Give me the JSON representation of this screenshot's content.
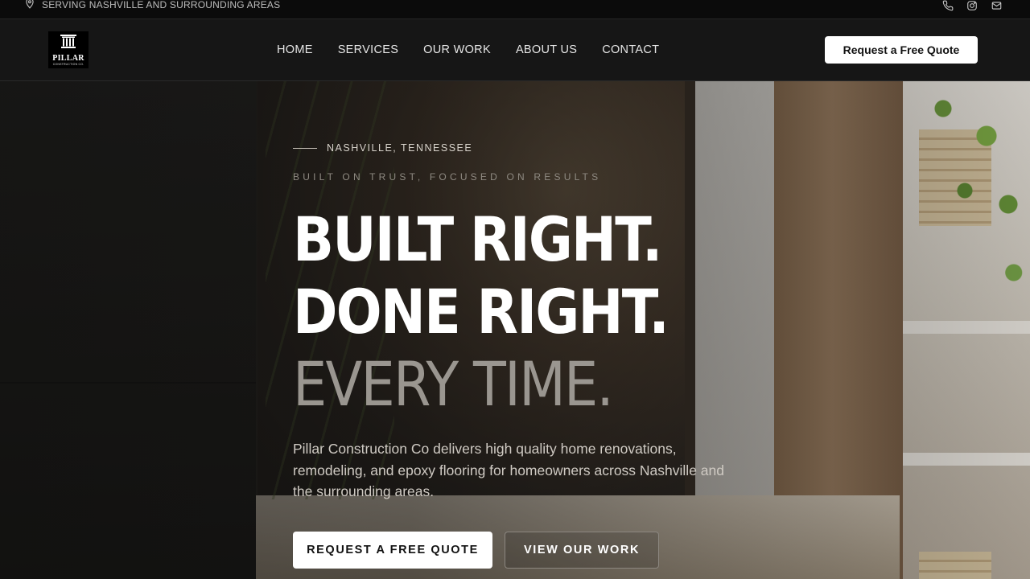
{
  "topbar": {
    "location_icon": "map-pin-icon",
    "location_text": "SERVING NASHVILLE AND SURROUNDING AREAS",
    "icons": [
      "phone-icon",
      "instagram-icon",
      "mail-icon"
    ]
  },
  "nav": {
    "logo": {
      "name": "PILLAR",
      "sub": "CONSTRUCTION CO."
    },
    "items": [
      "HOME",
      "SERVICES",
      "OUR WORK",
      "ABOUT US",
      "CONTACT"
    ],
    "cta_label": "Request a Free Quote"
  },
  "hero": {
    "eyebrow": "NASHVILLE, TENNESSEE",
    "tagline": "BUILT ON TRUST, FOCUSED ON RESULTS",
    "headline": {
      "line1": "BUILT RIGHT.",
      "line2": "DONE RIGHT.",
      "line3": "EVERY TIME."
    },
    "description": "Pillar Construction Co delivers high quality home renovations, remodeling, and epoxy flooring for homeowners across Nashville and the surrounding areas.",
    "primary_button": "REQUEST A FREE QUOTE",
    "secondary_button": "VIEW OUR WORK"
  },
  "colors": {
    "background": "#161616",
    "accent": "#ffffff",
    "muted_heading": "#9a9690"
  }
}
